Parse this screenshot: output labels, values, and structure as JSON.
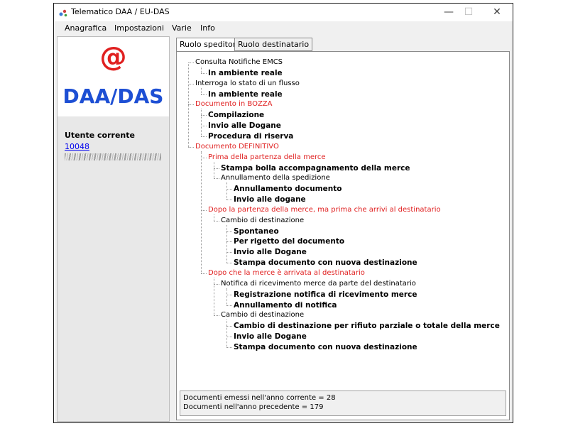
{
  "window": {
    "title": "Telematico DAA / EU-DAS",
    "minimize": "—",
    "maximize": "☐",
    "close": "✕"
  },
  "menu": [
    "Anagrafica",
    "Impostazioni",
    "Varie",
    "Info"
  ],
  "sidebar": {
    "logo_symbol": "@",
    "logo_text": "DAA/DAS",
    "user_label": "Utente corrente",
    "user_id": "10048"
  },
  "tabs": [
    {
      "label": "Ruolo speditore",
      "active": true
    },
    {
      "label": "Ruolo destinatario",
      "active": false
    }
  ],
  "tree": [
    {
      "label": "Consulta Notifiche EMCS",
      "level": 0,
      "style": "normal"
    },
    {
      "label": "In ambiente reale",
      "level": 1,
      "style": "bold"
    },
    {
      "label": "Interroga lo stato di un flusso",
      "level": 0,
      "style": "normal"
    },
    {
      "label": "In ambiente reale",
      "level": 1,
      "style": "bold"
    },
    {
      "label": "Documento in BOZZA",
      "level": 0,
      "style": "red"
    },
    {
      "label": "Compilazione",
      "level": 1,
      "style": "bold"
    },
    {
      "label": "Invio alle Dogane",
      "level": 1,
      "style": "bold"
    },
    {
      "label": "Procedura di riserva",
      "level": 1,
      "style": "bold"
    },
    {
      "label": "Documento DEFINITIVO",
      "level": 0,
      "style": "red"
    },
    {
      "label": "Prima della partenza della merce",
      "level": 1,
      "style": "red"
    },
    {
      "label": "Stampa bolla accompagnamento della merce",
      "level": 2,
      "style": "bold"
    },
    {
      "label": "Annullamento della spedizione",
      "level": 2,
      "style": "normal"
    },
    {
      "label": "Annullamento documento",
      "level": 3,
      "style": "bold"
    },
    {
      "label": "Invio alle dogane",
      "level": 3,
      "style": "bold"
    },
    {
      "label": "Dopo la partenza della merce, ma prima che arrivi al destinatario",
      "level": 1,
      "style": "red"
    },
    {
      "label": "Cambio di destinazione",
      "level": 2,
      "style": "normal"
    },
    {
      "label": "Spontaneo",
      "level": 3,
      "style": "bold"
    },
    {
      "label": "Per rigetto del documento",
      "level": 3,
      "style": "bold"
    },
    {
      "label": "Invio alle Dogane",
      "level": 3,
      "style": "bold"
    },
    {
      "label": "Stampa documento con nuova destinazione",
      "level": 3,
      "style": "bold"
    },
    {
      "label": "Dopo che la merce è arrivata al destinatario",
      "level": 1,
      "style": "red"
    },
    {
      "label": "Notifica di ricevimento merce da parte del destinatario",
      "level": 2,
      "style": "normal"
    },
    {
      "label": "Registrazione notifica di ricevimento merce",
      "level": 3,
      "style": "bold"
    },
    {
      "label": "Annullamento di notifica",
      "level": 3,
      "style": "bold"
    },
    {
      "label": "Cambio di destinazione",
      "level": 2,
      "style": "normal"
    },
    {
      "label": "Cambio di destinazione per rifiuto parziale o totale della merce",
      "level": 3,
      "style": "bold"
    },
    {
      "label": "Invio alle Dogane",
      "level": 3,
      "style": "bold"
    },
    {
      "label": "Stampa documento con nuova destinazione",
      "level": 3,
      "style": "bold"
    }
  ],
  "status": {
    "line1": "Documenti emessi nell'anno corrente = 28",
    "line2": "Documenti nell'anno precedente = 179"
  },
  "colors": {
    "accent_red": "#e02020",
    "logo_blue": "#1d4fd4",
    "link_blue": "#0000ee"
  }
}
